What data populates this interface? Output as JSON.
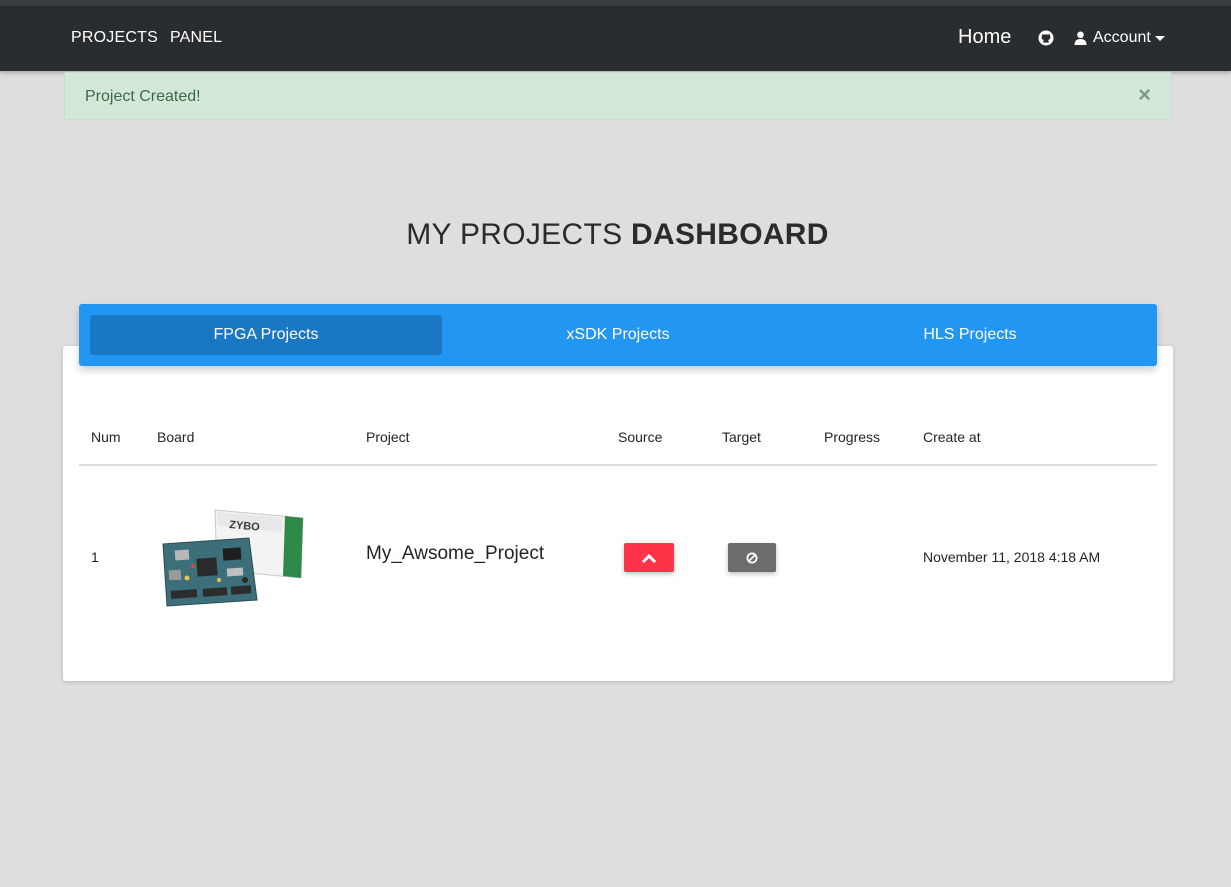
{
  "navbar": {
    "brand": [
      "PROJECTS",
      "PANEL"
    ],
    "home_label": "Home",
    "account_label": "Account"
  },
  "alert": {
    "message": "Project Created!",
    "close_symbol": "×"
  },
  "page_title": {
    "light": "MY PROJECTS",
    "bold": "DASHBOARD"
  },
  "tabs": [
    {
      "label": "FPGA Projects",
      "active": true
    },
    {
      "label": "xSDK Projects",
      "active": false
    },
    {
      "label": "HLS Projects",
      "active": false
    }
  ],
  "table": {
    "headers": [
      "Num",
      "Board",
      "Project",
      "Source",
      "Target",
      "Progress",
      "Create at"
    ],
    "rows": [
      {
        "num": "1",
        "board_image": "zybo-board",
        "board_logo_text": "ZYBO",
        "project": "My_Awsome_Project",
        "source_icon": "chevron-up-icon",
        "target_icon": "ban-icon",
        "progress": "",
        "created_at": "November 11, 2018 4:18 AM"
      }
    ]
  },
  "colors": {
    "navbar": "#2a2d30",
    "tabbar": "#2196f3",
    "active_tab": "#1a77c3",
    "alert_bg": "#d4e8d9",
    "source_btn": "#ff3347",
    "target_btn": "#6c6c6c"
  }
}
